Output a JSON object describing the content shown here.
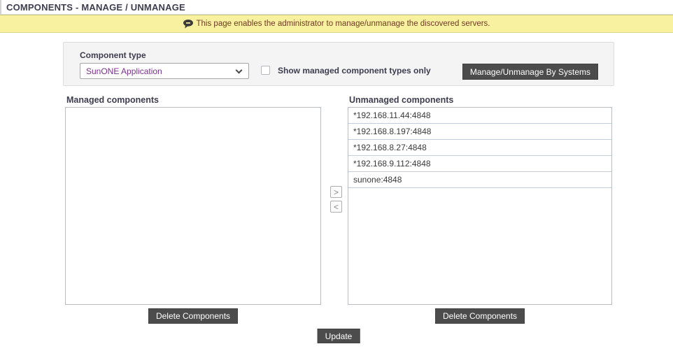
{
  "page": {
    "title": "COMPONENTS - MANAGE / UNMANAGE",
    "banner": {
      "icon": "comment-bubble",
      "text": "This page enables the administrator to manage/unmanage the discovered servers."
    },
    "filter_panel": {
      "component_type_label": "Component type",
      "component_type_value": "SunONE Application",
      "show_managed_label": "Show managed component types only",
      "show_managed_checked": false,
      "manage_by_systems_button": "Manage/Unmanage By Systems"
    },
    "managed": {
      "label": "Managed components",
      "items": [],
      "delete_button": "Delete Components"
    },
    "unmanaged": {
      "label": "Unmanaged components",
      "items": [
        "*192.168.11.44:4848",
        "*192.168.8.197:4848",
        "*192.168.8.27:4848",
        "*192.168.9.112:4848",
        "sunone:4848"
      ],
      "delete_button": "Delete Components"
    },
    "transfer": {
      "to_unmanaged": ">",
      "to_managed": "<"
    },
    "update_button": "Update",
    "colors": {
      "banner_bg": "#f8f1a0",
      "banner_text": "#6e3a22",
      "heading_text": "#3d3d4f",
      "button_bg": "#4c4c4c",
      "dropdown_value_text": "#7b2f8e",
      "list_row_border": "#c4cbda"
    }
  }
}
